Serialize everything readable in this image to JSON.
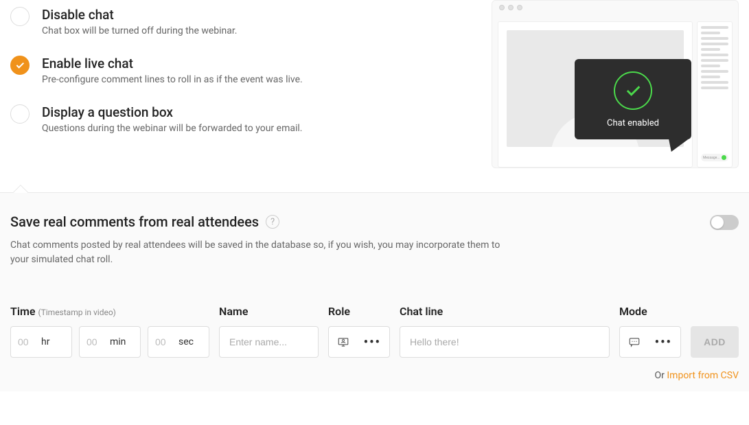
{
  "options": {
    "disable": {
      "title": "Disable chat",
      "desc": "Chat box will be turned off during the webinar."
    },
    "enable": {
      "title": "Enable live chat",
      "desc": "Pre-configure comment lines to roll in as if the event was live."
    },
    "question": {
      "title": "Display a question box",
      "desc": "Questions during the webinar will be forwarded to your email."
    }
  },
  "preview": {
    "tooltip_label": "Chat enabled",
    "msg_placeholder": "Message..."
  },
  "save_section": {
    "title": "Save real comments from real attendees",
    "desc": "Chat comments posted by real attendees will be saved in the database so, if you wish, you may incorporate them to your simulated chat roll."
  },
  "form": {
    "time_label": "Time",
    "time_hint": "(Timestamp in video)",
    "hr_ph": "00",
    "hr_unit": "hr",
    "min_ph": "00",
    "min_unit": "min",
    "sec_ph": "00",
    "sec_unit": "sec",
    "name_label": "Name",
    "name_ph": "Enter name...",
    "role_label": "Role",
    "chat_label": "Chat line",
    "chat_ph": "Hello there!",
    "mode_label": "Mode",
    "add_label": "ADD",
    "or_text": "Or ",
    "import_text": "Import from CSV"
  }
}
